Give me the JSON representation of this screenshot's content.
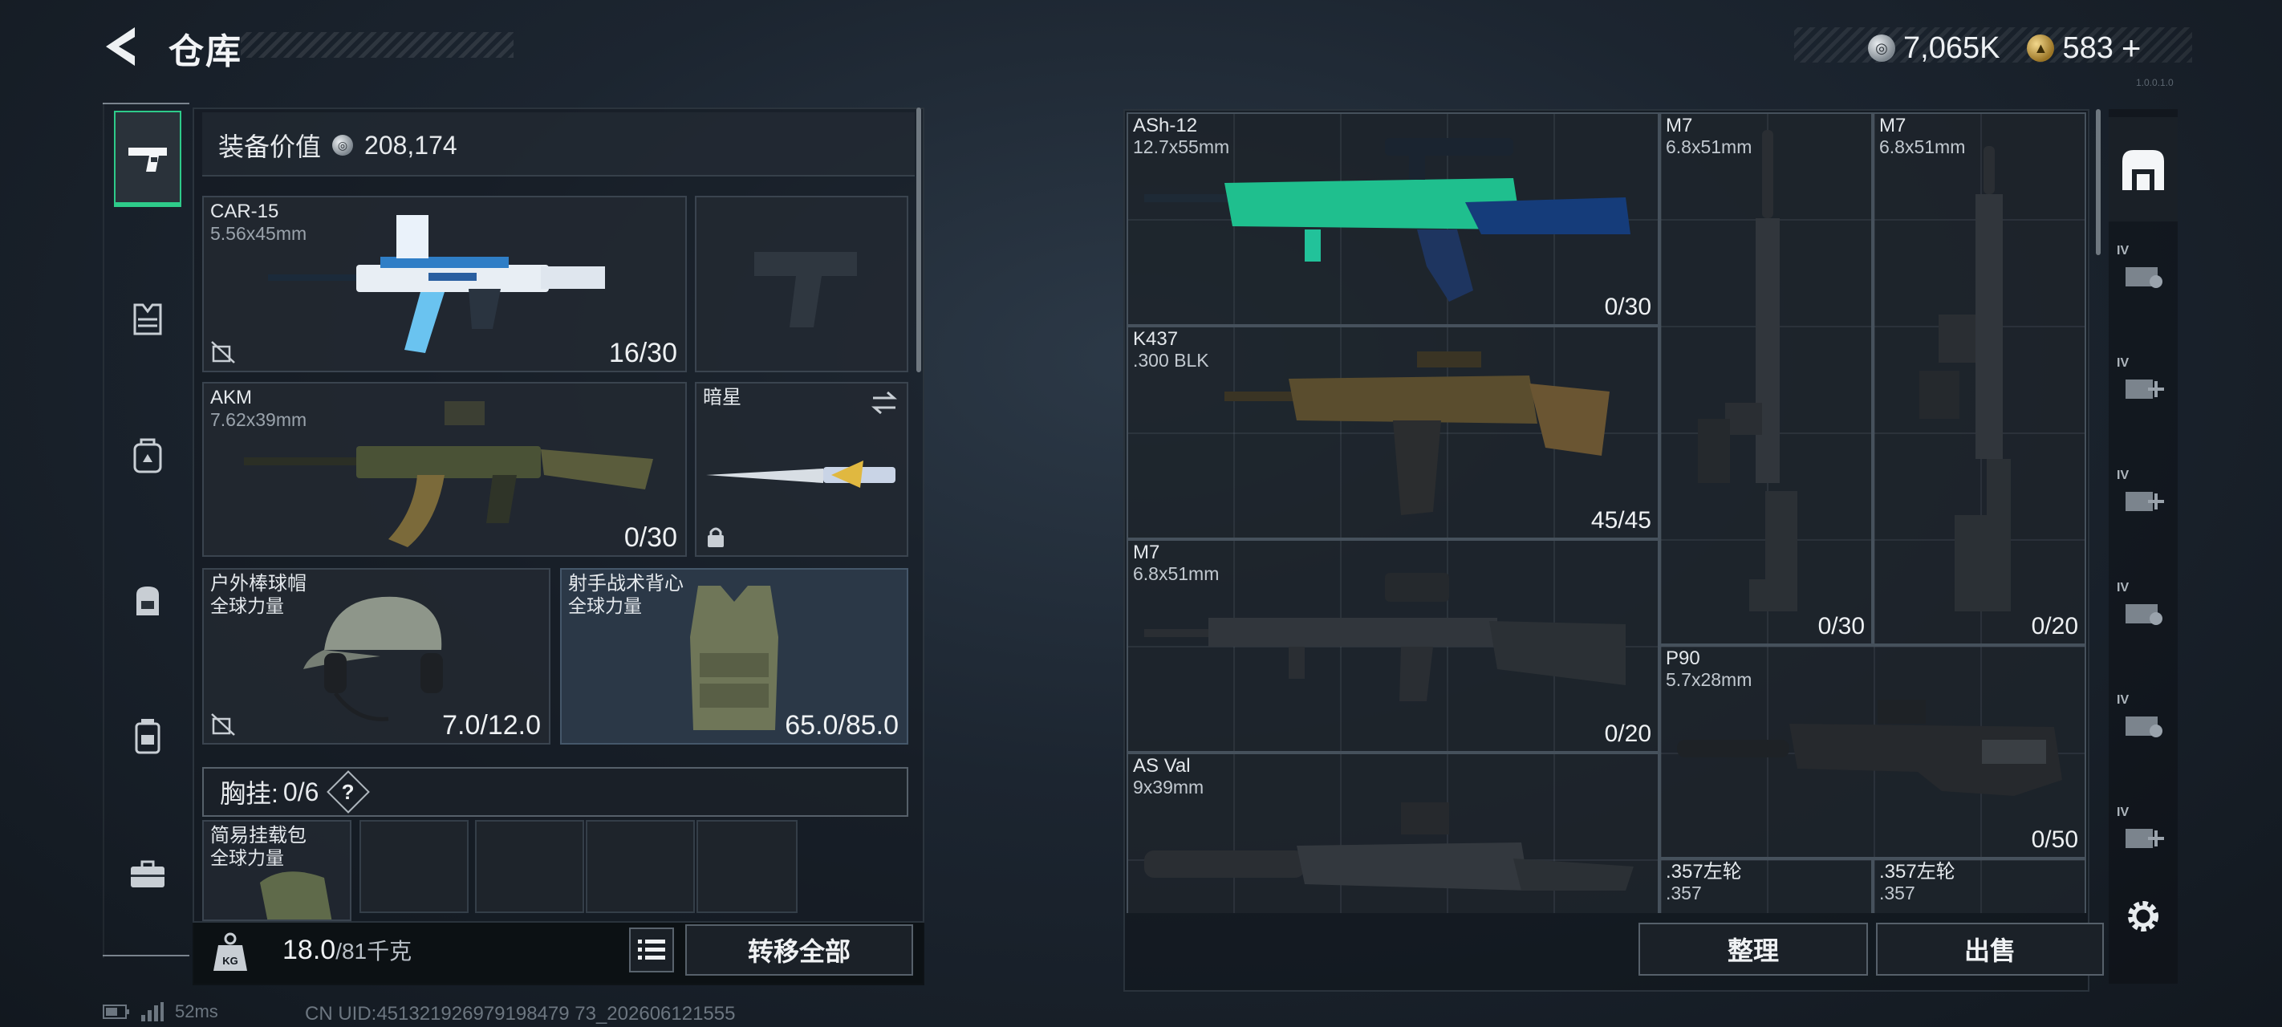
{
  "header": {
    "title": "仓库",
    "silver_amount": "7,065K",
    "gold_amount": "583",
    "gold_add": "+",
    "version_text": "1.0.0.1.0"
  },
  "left_nav": {
    "items": [
      {
        "icon": "pistol-icon",
        "active": true
      },
      {
        "icon": "armor-vest-icon",
        "active": false
      },
      {
        "icon": "pouch-icon",
        "active": false
      },
      {
        "icon": "backpack-icon",
        "active": false
      },
      {
        "icon": "large-backpack-icon",
        "active": false
      },
      {
        "icon": "toolbox-icon",
        "active": false
      }
    ]
  },
  "equipment": {
    "value_label": "装备价值",
    "value": "208,174",
    "primary_weapon": {
      "name": "CAR-15",
      "caliber": "5.56x45mm",
      "ammo": "16/30"
    },
    "sidearm": {
      "name": ""
    },
    "secondary_weapon": {
      "name": "AKM",
      "caliber": "7.62x39mm",
      "ammo": "0/30"
    },
    "melee": {
      "name": "暗星"
    },
    "helmet": {
      "name": "户外棒球帽",
      "faction": "全球力量",
      "durability": "7.0/12.0"
    },
    "armor": {
      "name": "射手战术背心",
      "faction": "全球力量",
      "durability": "65.0/85.0"
    },
    "chest_rig": {
      "label": "胸挂:",
      "count": "0/6",
      "help": "?"
    },
    "pouch": {
      "name": "简易挂载包",
      "faction": "全球力量"
    },
    "weight_current": "18.0",
    "weight_max": "/81千克",
    "transfer_all_label": "转移全部"
  },
  "storage": {
    "items": [
      {
        "name": "ASh-12",
        "caliber": "12.7x55mm",
        "ammo": "0/30"
      },
      {
        "name": "M7",
        "caliber": "6.8x51mm",
        "ammo": "0/30"
      },
      {
        "name": "M7",
        "caliber": "6.8x51mm",
        "ammo": "0/20"
      },
      {
        "name": "K437",
        "caliber": ".300 BLK",
        "ammo": "45/45"
      },
      {
        "name": "M7",
        "caliber": "6.8x51mm",
        "ammo": "0/20"
      },
      {
        "name": "P90",
        "caliber": "5.7x28mm",
        "ammo": "0/50"
      },
      {
        "name": "AS Val",
        "caliber": "9x39mm",
        "ammo": ""
      },
      {
        "name": ".357左轮",
        "caliber": ".357",
        "ammo": ""
      },
      {
        "name": ".357左轮",
        "caliber": ".357",
        "ammo": ""
      }
    ],
    "sort_label": "整理",
    "sell_label": "出售"
  },
  "right_tabs": {
    "level_label": "IV"
  },
  "status_bar": {
    "ping": "52ms",
    "uid": "CN UID:451321926979198479 73_202606121555"
  },
  "colors": {
    "accent_green": "#2ecb8a",
    "panel_bg": "#232a32",
    "vest_slot_bg": "#2c3a49"
  }
}
